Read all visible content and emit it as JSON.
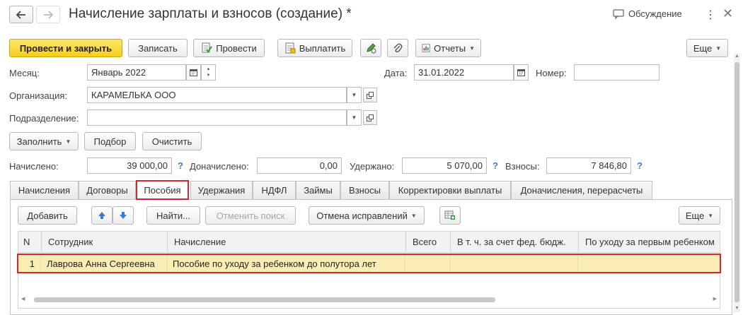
{
  "window": {
    "title": "Начисление зарплаты и взносов (создание) *",
    "discussion_label": "Обсуждение"
  },
  "toolbar": {
    "post_close": "Провести и закрыть",
    "write": "Записать",
    "post": "Провести",
    "pay": "Выплатить",
    "reports": "Отчеты",
    "more": "Еще"
  },
  "form": {
    "month_label": "Месяц:",
    "month_value": "Январь 2022",
    "date_label": "Дата:",
    "date_value": "31.01.2022",
    "number_label": "Номер:",
    "number_value": "",
    "org_label": "Организация:",
    "org_value": "КАРАМЕЛЬКА ООО",
    "dept_label": "Подразделение:",
    "dept_value": ""
  },
  "actions": {
    "fill": "Заполнить",
    "select": "Подбор",
    "clear": "Очистить"
  },
  "totals": {
    "accrued_label": "Начислено:",
    "accrued_value": "39 000,00",
    "additional_label": "Доначислено:",
    "additional_value": "0,00",
    "withheld_label": "Удержано:",
    "withheld_value": "5 070,00",
    "contrib_label": "Взносы:",
    "contrib_value": "7 846,80",
    "help": "?"
  },
  "tabs": [
    "Начисления",
    "Договоры",
    "Пособия",
    "Удержания",
    "НДФЛ",
    "Займы",
    "Взносы",
    "Корректировки выплаты",
    "Доначисления, перерасчеты"
  ],
  "active_tab": "Пособия",
  "tab_toolbar": {
    "add": "Добавить",
    "find": "Найти...",
    "cancel_search": "Отменить поиск",
    "cancel_corrections": "Отмена исправлений",
    "more": "Еще"
  },
  "table": {
    "columns": [
      "N",
      "Сотрудник",
      "Начисление",
      "Всего",
      "В т. ч. за счет фед. бюдж.",
      "По уходу за первым ребенком"
    ],
    "rows": [
      [
        "1",
        "Лаврова Анна Сергеевна",
        "Пособие по уходу за ребенком до полутора лет",
        "",
        "",
        ""
      ]
    ]
  },
  "colors": {
    "accent_yellow": "#f5cf1c",
    "selected_row": "#fbeeb4",
    "highlight_red": "#d6262f",
    "help_blue": "#3a7ad5"
  }
}
